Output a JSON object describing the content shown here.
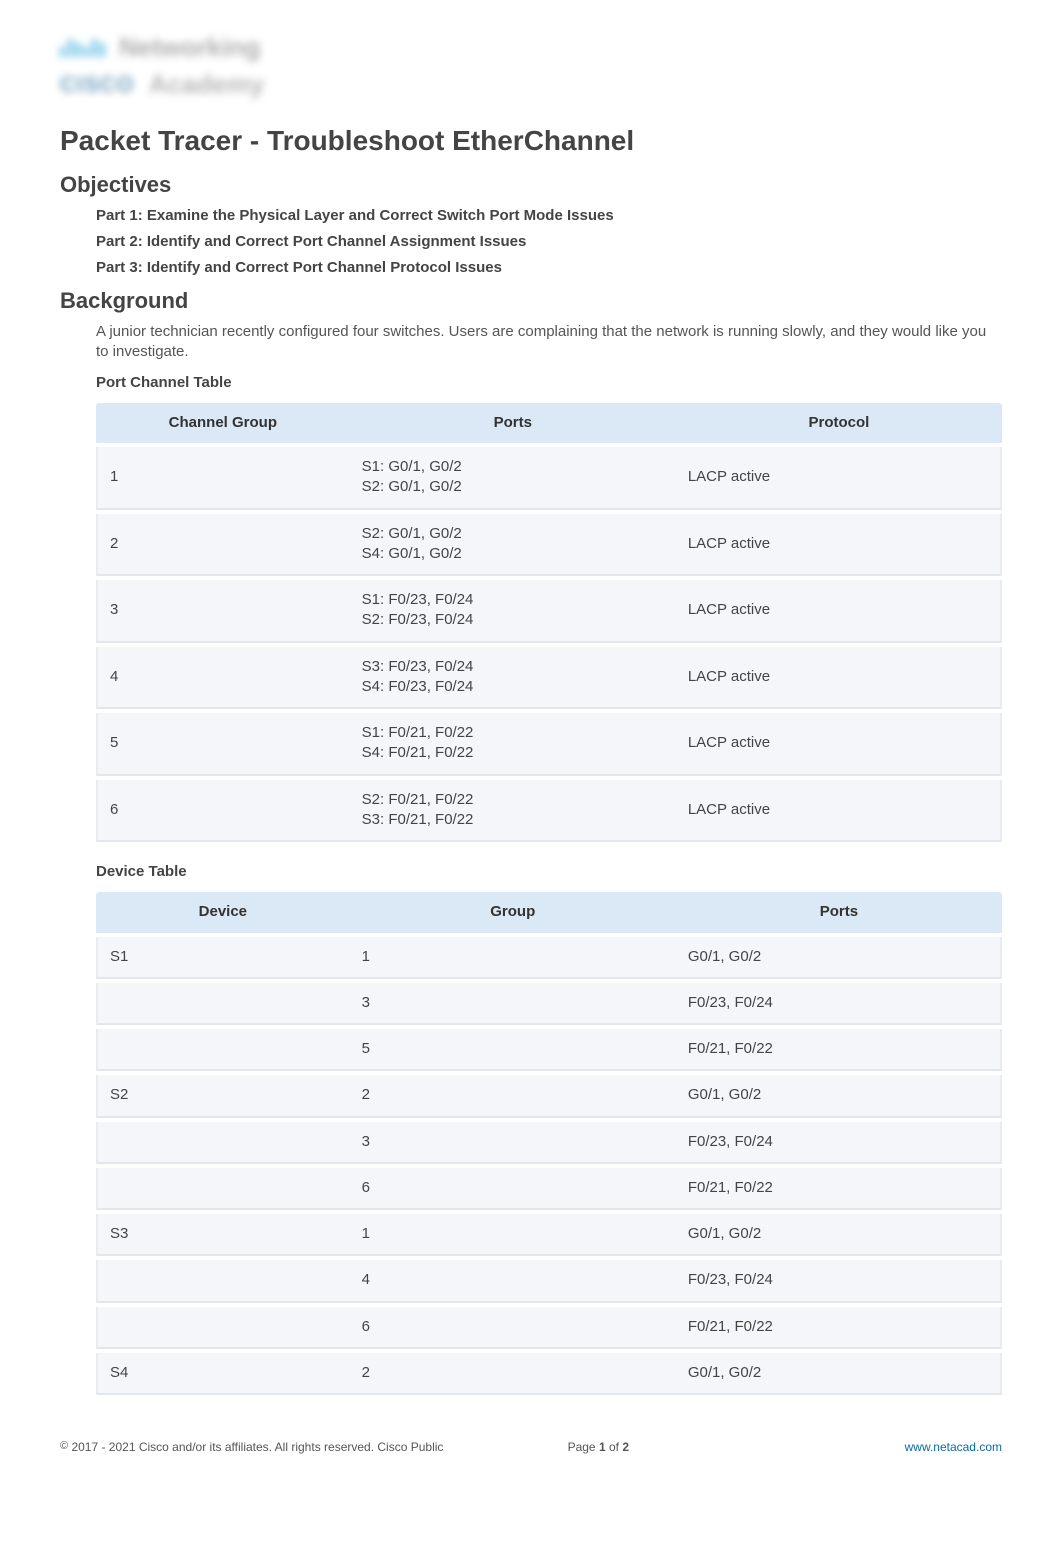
{
  "logo": {
    "word1": "Networking",
    "brand": "CISCO",
    "word2": "Academy"
  },
  "title": "Packet Tracer - Troubleshoot EtherChannel",
  "sections": {
    "objectives_heading": "Objectives",
    "objectives": [
      "Part 1: Examine the Physical Layer and Correct Switch Port Mode Issues",
      "Part 2: Identify and Correct Port Channel Assignment Issues",
      "Part 3: Identify and Correct Port Channel Protocol Issues"
    ],
    "background_heading": "Background",
    "background_text": "A junior technician recently configured four switches. Users are complaining that the network is running slowly, and they would like you to investigate."
  },
  "port_channel_table": {
    "caption": "Port Channel Table",
    "headers": [
      "Channel Group",
      "Ports",
      "Protocol"
    ],
    "rows": [
      {
        "group": "1",
        "ports": "S1: G0/1, G0/2\nS2: G0/1, G0/2",
        "protocol": "LACP active"
      },
      {
        "group": "2",
        "ports": "S2: G0/1, G0/2\nS4: G0/1, G0/2",
        "protocol": "LACP active"
      },
      {
        "group": "3",
        "ports": "S1: F0/23, F0/24\nS2: F0/23, F0/24",
        "protocol": "LACP active"
      },
      {
        "group": "4",
        "ports": "S3: F0/23, F0/24\nS4: F0/23, F0/24",
        "protocol": "LACP active"
      },
      {
        "group": "5",
        "ports": "S1: F0/21, F0/22\nS4: F0/21, F0/22",
        "protocol": "LACP active"
      },
      {
        "group": "6",
        "ports": "S2: F0/21, F0/22\nS3: F0/21, F0/22",
        "protocol": "LACP active"
      }
    ]
  },
  "device_table": {
    "caption": "Device Table",
    "headers": [
      "Device",
      "Group",
      "Ports"
    ],
    "rows": [
      {
        "device": "S1",
        "group": "1",
        "ports": "G0/1, G0/2"
      },
      {
        "device": "",
        "group": "3",
        "ports": "F0/23, F0/24"
      },
      {
        "device": "",
        "group": "5",
        "ports": "F0/21, F0/22"
      },
      {
        "device": "S2",
        "group": "2",
        "ports": "G0/1, G0/2"
      },
      {
        "device": "",
        "group": "3",
        "ports": "F0/23, F0/24"
      },
      {
        "device": "",
        "group": "6",
        "ports": "F0/21, F0/22"
      },
      {
        "device": "S3",
        "group": "1",
        "ports": "G0/1, G0/2"
      },
      {
        "device": "",
        "group": "4",
        "ports": "F0/23, F0/24"
      },
      {
        "device": "",
        "group": "6",
        "ports": "F0/21, F0/22"
      },
      {
        "device": "S4",
        "group": "2",
        "ports": "G0/1, G0/2"
      }
    ]
  },
  "footer": {
    "copyright_symbol": "©",
    "left": " 2017 - 2021 Cisco and/or its affiliates. All rights reserved. Cisco Public",
    "page_prefix": "Page ",
    "page_current": "1",
    "page_of": " of ",
    "page_total": "2",
    "link": "www.netacad.com"
  }
}
